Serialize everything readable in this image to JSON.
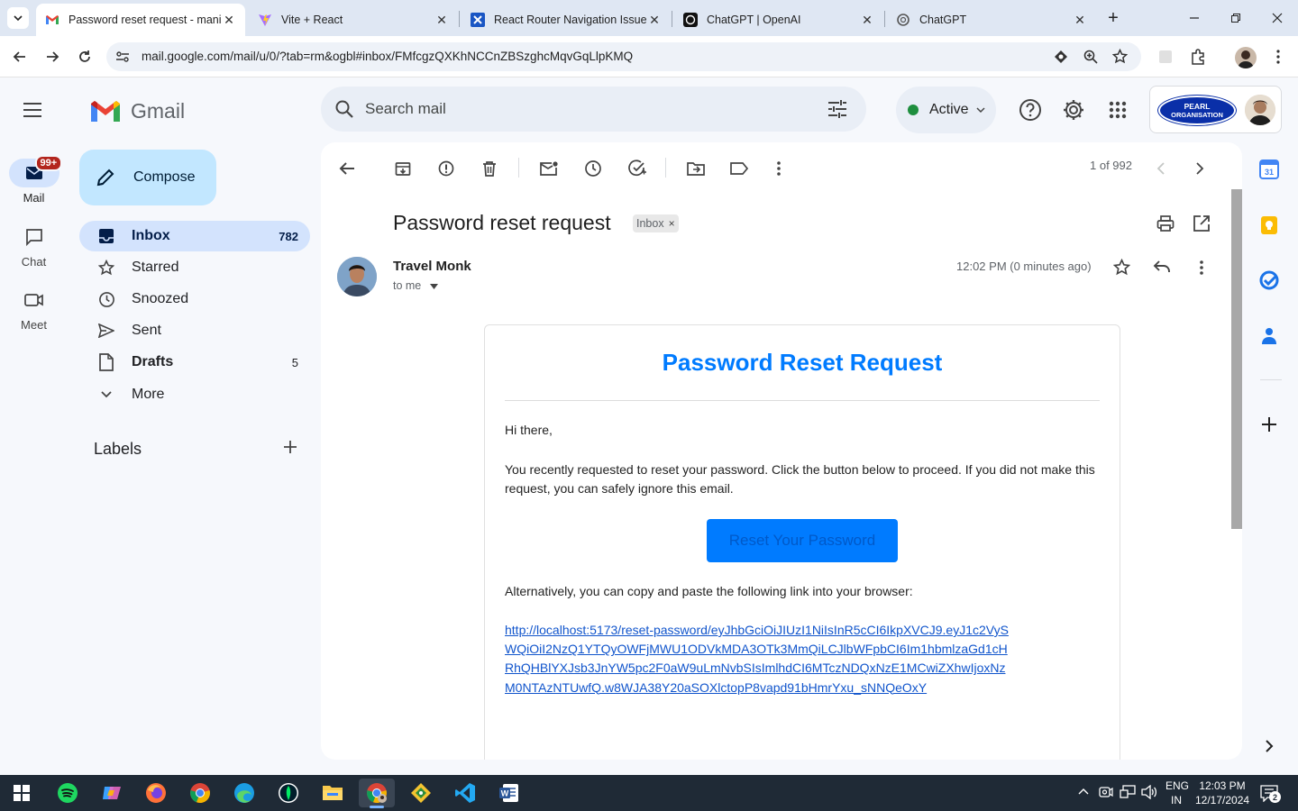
{
  "browser": {
    "tabs": [
      {
        "title": "Password reset request - manis",
        "active": true,
        "icon": "gmail-icon"
      },
      {
        "title": "Vite + React",
        "active": false,
        "icon": "vite-icon"
      },
      {
        "title": "React Router Navigation Issue |",
        "active": false,
        "icon": "react-router-icon"
      },
      {
        "title": "ChatGPT | OpenAI",
        "active": false,
        "icon": "openai-icon"
      },
      {
        "title": "ChatGPT",
        "active": false,
        "icon": "chatgpt-icon"
      }
    ],
    "url": "mail.google.com/mail/u/0/?tab=rm&ogbl#inbox/FMfcgzQXKhNCCnZBSzghcMqvGqLlpKMQ"
  },
  "rail": {
    "mail_label": "Mail",
    "mail_badge": "99+",
    "chat_label": "Chat",
    "meet_label": "Meet"
  },
  "gmail": {
    "logo_text": "Gmail",
    "compose_label": "Compose",
    "nav": [
      {
        "label": "Inbox",
        "count": "782",
        "icon": "inbox-icon",
        "selected": true
      },
      {
        "label": "Starred",
        "count": "",
        "icon": "star-icon",
        "selected": false
      },
      {
        "label": "Snoozed",
        "count": "",
        "icon": "clock-icon",
        "selected": false
      },
      {
        "label": "Sent",
        "count": "",
        "icon": "send-icon",
        "selected": false
      },
      {
        "label": "Drafts",
        "count": "5",
        "icon": "draft-icon",
        "selected": false
      },
      {
        "label": "More",
        "count": "",
        "icon": "chevron-down-icon",
        "selected": false
      }
    ],
    "labels_heading": "Labels",
    "search_placeholder": "Search mail",
    "status": "Active",
    "account_org_line1": "PEARL",
    "account_org_line2": "ORGANISATION"
  },
  "toolbar": {
    "pagination": "1 of 992"
  },
  "email": {
    "subject": "Password reset request",
    "label_chip": "Inbox",
    "sender": "Travel Monk",
    "recipient": "to me",
    "time": "12:02 PM (0 minutes ago)",
    "body": {
      "title": "Password Reset Request",
      "greeting": "Hi there,",
      "paragraph": "You recently requested to reset your password. Click the button below to proceed. If you did not make this request, you can safely ignore this email.",
      "button": "Reset Your Password",
      "alt_text": "Alternatively, you can copy and paste the following link into your browser:",
      "link": "http://localhost:5173/reset-password/eyJhbGciOiJIUzI1NiIsInR5cCI6IkpXVCJ9.eyJ1c2VySWQiOiI2NzQ1YTQyOWFjMWU1ODVkMDA3OTk3MmQiLCJlbWFpbCI6Im1hbmlzaGd1cHRhQHBlYXJsb3JnYW5pc2F0aW9uLmNvbSIsImlhdCI6MTczNDQxNzE1MCwiZXhwIjoxNzM0NTAzNTUwfQ.w8WJA38Y20aSOXlctopP8vapd91bHmrYxu_sNNQeOxY"
    }
  },
  "taskbar": {
    "lang_line1": "ENG",
    "lang_line2": "IN",
    "time": "12:03 PM",
    "date": "12/17/2024",
    "notif_count": "2"
  },
  "colors": {
    "accent_blue": "#007bff",
    "gmail_red": "#ea4335",
    "inbox_selected": "#d3e3fd",
    "compose_bg": "#c2e7ff",
    "active_green": "#1e8e3e"
  }
}
